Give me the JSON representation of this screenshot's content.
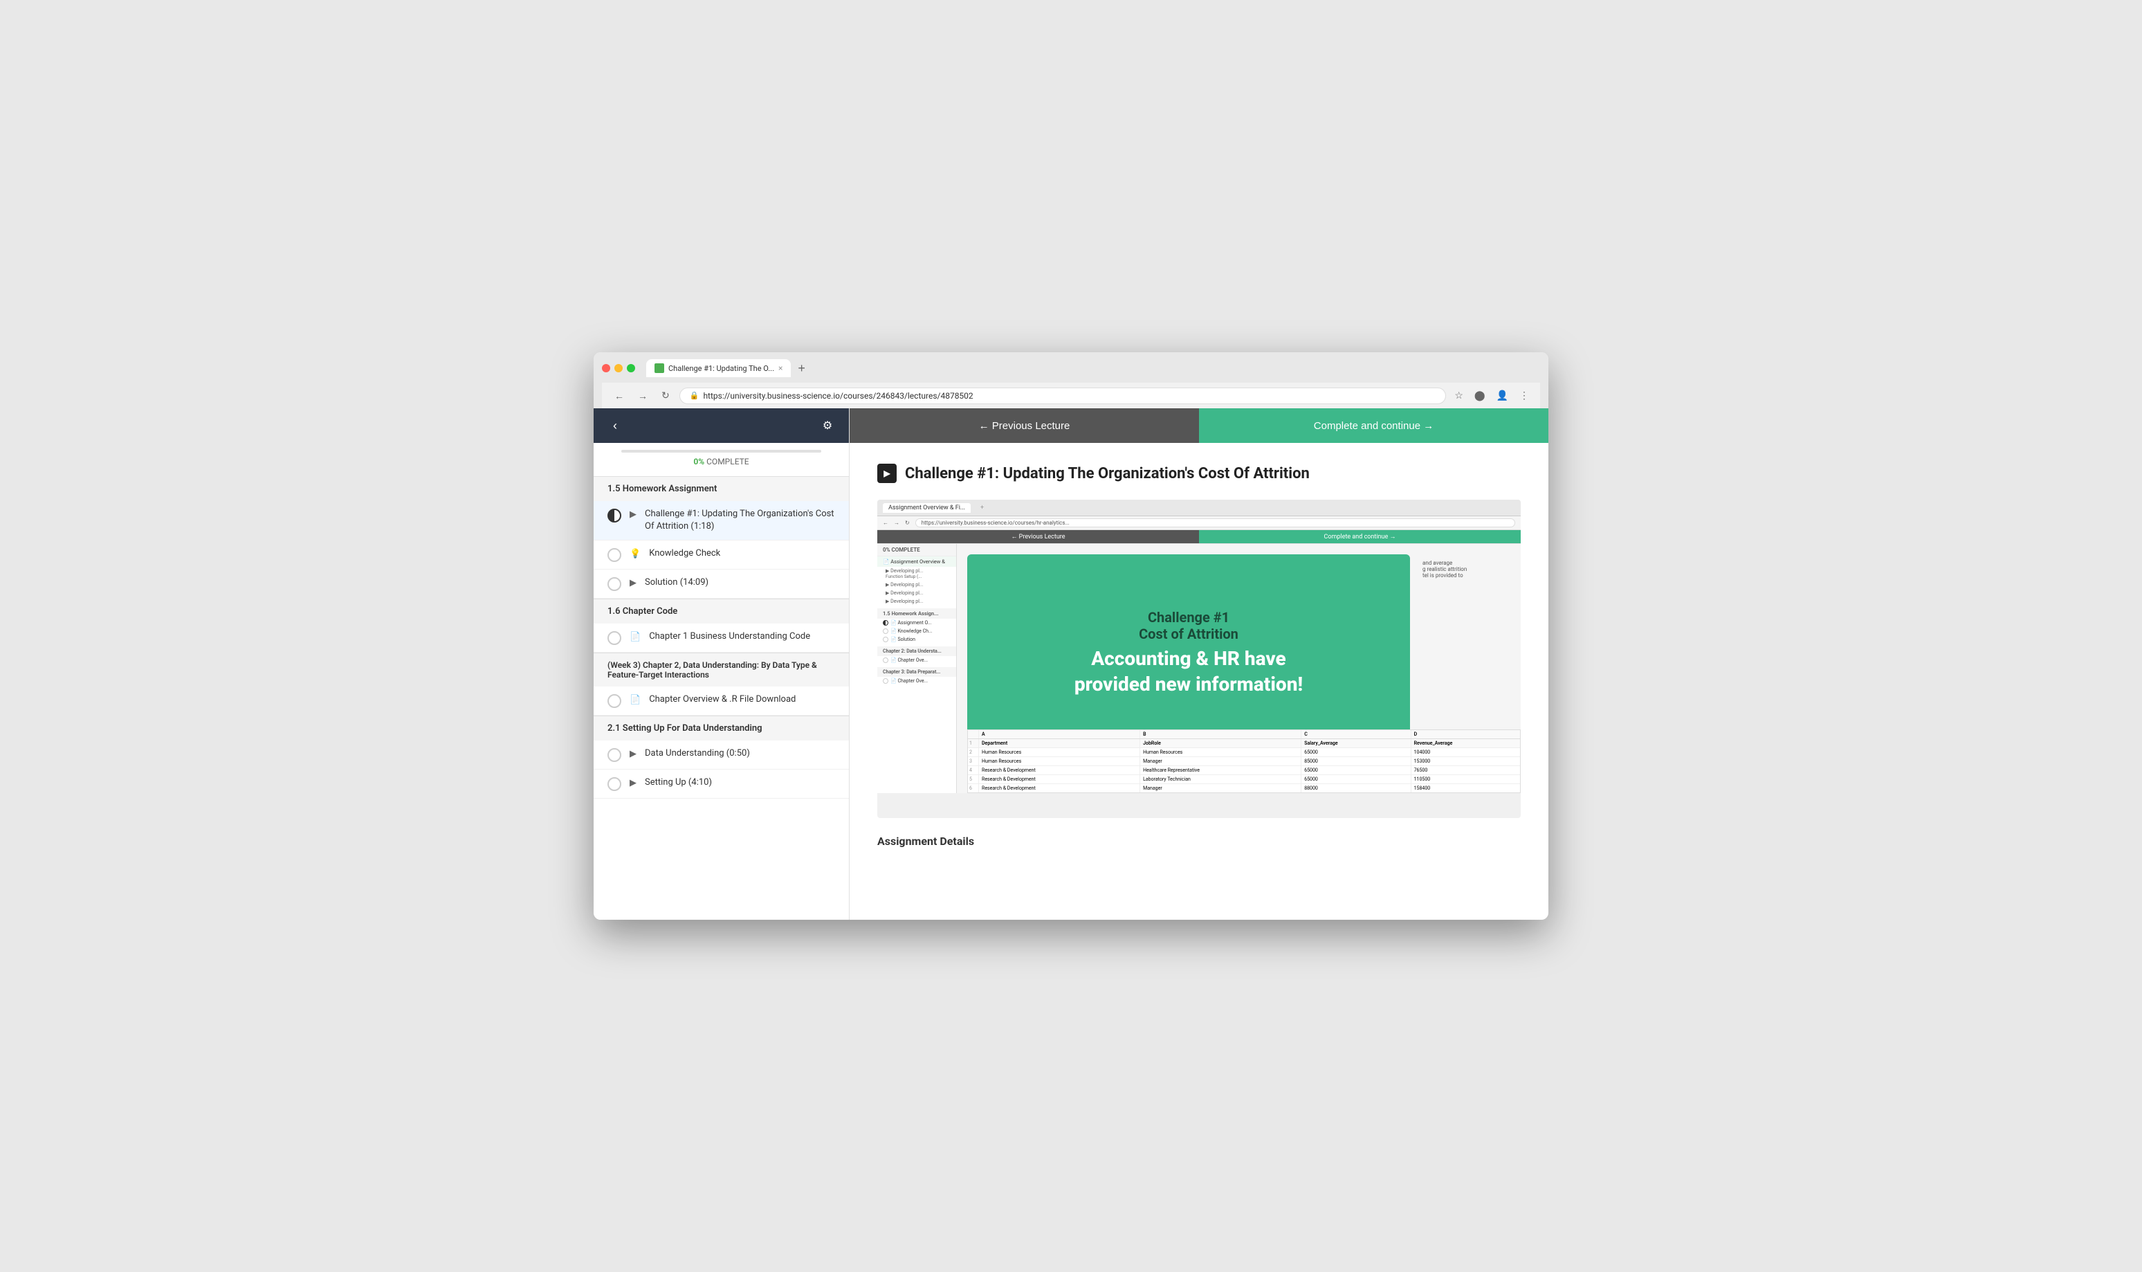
{
  "browser": {
    "tab_title": "Challenge #1: Updating The O...",
    "url": "https://university.business-science.io/courses/246843/lectures/4878502",
    "new_tab_label": "+"
  },
  "nav": {
    "prev_lecture": "← Previous Lecture",
    "complete_continue": "Complete and continue →"
  },
  "sidebar": {
    "progress_pct": "0%",
    "progress_label": "COMPLETE",
    "gear_icon": "⚙",
    "back_icon": "‹",
    "sections": [
      {
        "header": "1.5 Homework Assignment",
        "items": [
          {
            "text": "Challenge #1: Updating The Organization's Cost Of Attrition (1:18)",
            "icon": "▶",
            "circle_type": "half",
            "active": true
          },
          {
            "text": "Knowledge Check",
            "icon": "💡",
            "circle_type": "empty"
          },
          {
            "text": "Solution (14:09)",
            "icon": "▶",
            "circle_type": "empty"
          }
        ]
      },
      {
        "header": "1.6 Chapter Code",
        "items": [
          {
            "text": "Chapter 1 Business Understanding Code",
            "icon": "📄",
            "circle_type": "empty"
          }
        ]
      },
      {
        "header": "(Week 3) Chapter 2, Data Understanding: By Data Type & Feature-Target Interactions",
        "items": []
      },
      {
        "header": "",
        "items": [
          {
            "text": "Chapter Overview & .R File Download",
            "icon": "📄",
            "circle_type": "empty"
          }
        ]
      },
      {
        "header": "2.1 Setting Up For Data Understanding",
        "items": [
          {
            "text": "Data Understanding (0:50)",
            "icon": "▶",
            "circle_type": "empty"
          },
          {
            "text": "Setting Up (4:10)",
            "icon": "▶",
            "circle_type": "empty"
          }
        ]
      }
    ]
  },
  "main": {
    "title": "Challenge #1: Updating The Organization's Cost Of Attrition",
    "assignment_details_label": "Assignment Details",
    "preview": {
      "challenge_title": "Challenge #1\nCost of Attrition",
      "challenge_body": "Accounting & HR have provided new information!",
      "assignment_overview_label": "Assignment Overview &",
      "sidebar_items": [
        "Developing Function Setup",
        "Developing pl...",
        "Developing pl...",
        "Developing pl..."
      ],
      "homework_header": "1.5 Homework Assignment",
      "sub_items": [
        "Assignment O...",
        "Knowledge Ch...",
        "Solution"
      ],
      "chapter2_header": "Chapter 2: Data Understa...",
      "chapter3_header": "Chapter 3: Data Preparat...",
      "right_info": "and average\ng realistic attrition\ntel is provided to",
      "table_headers": [
        "",
        "A",
        "B",
        "C",
        "D"
      ],
      "table_col_headers": [
        "",
        "Department",
        "JobRole",
        "Salary_Average",
        "Revenue_Average"
      ],
      "table_rows": [
        [
          "2",
          "Human Resources",
          "Human Resources",
          "65000",
          "104000"
        ],
        [
          "3",
          "Human Resources",
          "Manager",
          "85000",
          "153000"
        ],
        [
          "4",
          "Research & Development",
          "Healthcare Representative",
          "65000",
          "76500"
        ],
        [
          "5",
          "Research & Development",
          "Laboratory Technician",
          "65000",
          "110500"
        ],
        [
          "6",
          "Research & Development",
          "Manager",
          "88000",
          "158400"
        ]
      ]
    }
  }
}
